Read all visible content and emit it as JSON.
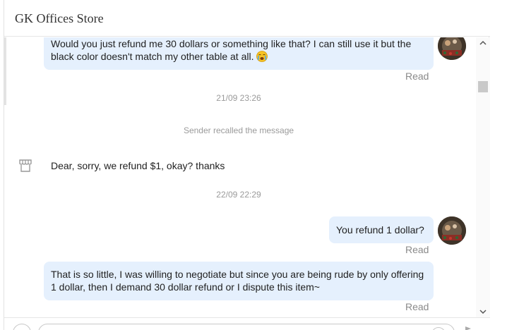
{
  "header": {
    "title": "GK Offices Store"
  },
  "messages": [
    {
      "text": "Would you just refund me 30 dollars or something like that? I can still use it but the black color doesn't match my other table at all.",
      "emoji_icon": "crying-face-emoji",
      "status": "Read"
    },
    {
      "timestamp": "21/09 23:26"
    },
    {
      "system": "Sender recalled the message"
    },
    {
      "text": "Dear, sorry, we refund $1, okay? thanks",
      "sender_icon": "store-icon"
    },
    {
      "timestamp": "22/09 22:29"
    },
    {
      "text": "You refund 1 dollar?",
      "status": "Read"
    },
    {
      "text": "That is so little, I was willing to negotiate but since you are being rude by only offering 1 dollar, then I demand 30 dollar refund or I dispute this item~",
      "status": "Read"
    }
  ],
  "colors": {
    "bubble": "#e5f0fd",
    "read": "#8a8a8a",
    "timestamp": "#9a9a9a"
  }
}
